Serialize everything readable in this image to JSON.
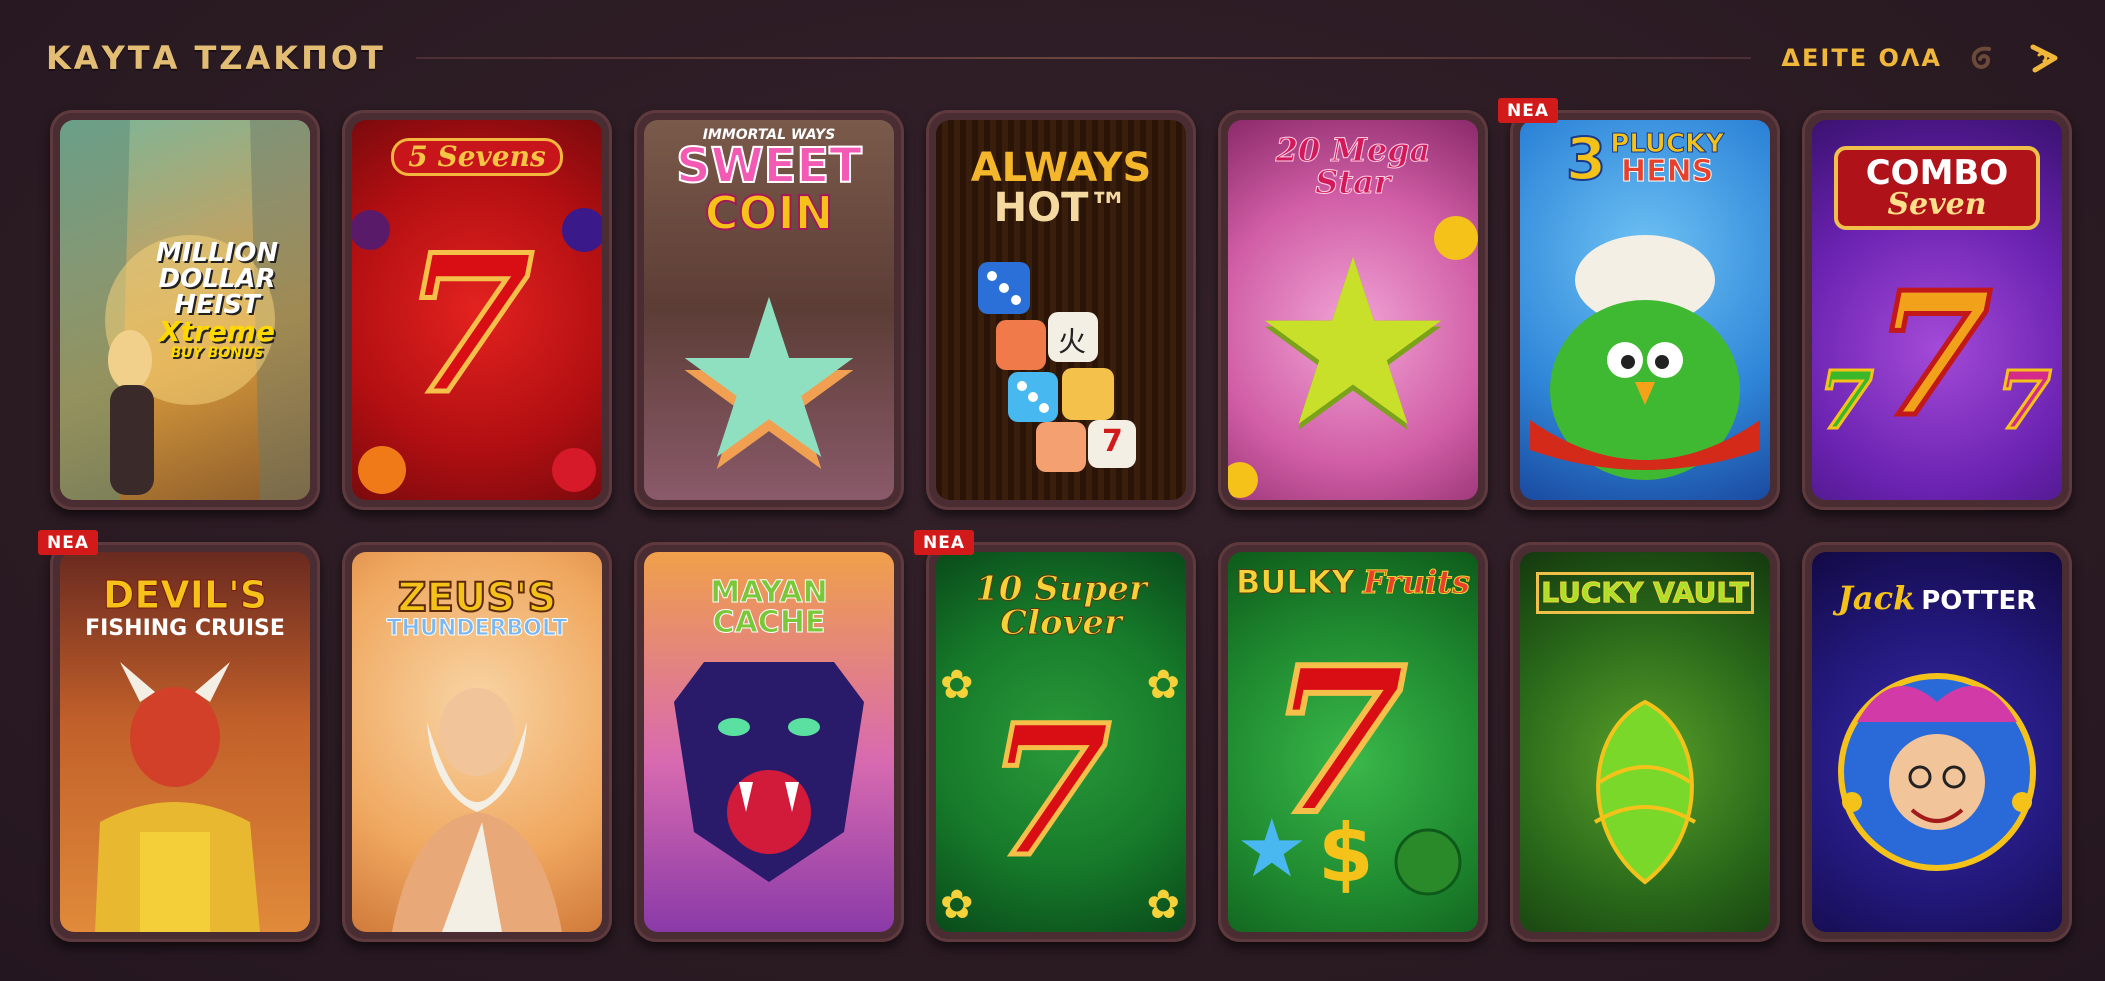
{
  "section": {
    "title": "ΚΑΥΤΑ ΤΖΑΚΠΟΤ",
    "see_all_label": "ΔΕΙΤΕ ΟΛΑ",
    "prev_icon": "swirl-left-icon",
    "next_icon": "swirl-right-icon"
  },
  "games": [
    {
      "name": "Million Dollar Heist Xtreme",
      "title_lines": [
        "MILLION",
        "DOLLAR",
        "HEIST",
        "Xtreme",
        "BUY BONUS"
      ],
      "badge": ""
    },
    {
      "name": "5 Sevens",
      "title_lines": [
        "5 Sevens"
      ],
      "badge": ""
    },
    {
      "name": "Sweet Coin",
      "title_lines": [
        "IMMORTAL WAYS",
        "SWEET",
        "COIN"
      ],
      "badge": ""
    },
    {
      "name": "Always Hot",
      "title_lines": [
        "ALWAYS",
        "HOT™"
      ],
      "badge": ""
    },
    {
      "name": "20 Mega Star",
      "title_lines": [
        "20 Mega",
        "Star"
      ],
      "badge": ""
    },
    {
      "name": "3 Plucky Hens",
      "title_lines": [
        "3",
        "PLUCKY",
        "HENS"
      ],
      "badge": "NEA"
    },
    {
      "name": "Combo Seven",
      "title_lines": [
        "COMBO",
        "Seven"
      ],
      "badge": ""
    },
    {
      "name": "Devil's Fishing Cruise",
      "title_lines": [
        "DEVIL'S",
        "FISHING CRUISE"
      ],
      "badge": "NEA"
    },
    {
      "name": "Zeus's Thunderbolt",
      "title_lines": [
        "ZEUS'S",
        "THUNDERBOLT"
      ],
      "badge": ""
    },
    {
      "name": "Mayan Cache",
      "title_lines": [
        "MAYAN CACHE"
      ],
      "badge": ""
    },
    {
      "name": "10 Super Clover",
      "title_lines": [
        "10 Super",
        "Clover"
      ],
      "badge": "NEA"
    },
    {
      "name": "Bulky Fruits",
      "title_lines": [
        "BULKY",
        "Fruits"
      ],
      "badge": ""
    },
    {
      "name": "Lucky Vault",
      "title_lines": [
        "LUCKY VAULT"
      ],
      "badge": ""
    },
    {
      "name": "Jack Potter",
      "title_lines": [
        "Jack",
        "POTTER"
      ],
      "badge": ""
    }
  ],
  "art_glyphs": {
    "seven": "7",
    "dice_glyphs": [
      "火",
      "7"
    ],
    "dollar": "$",
    "star": "★",
    "clover": "✿"
  },
  "colors": {
    "background": "#2d1d25",
    "accent_gold": "#f0b73a",
    "badge_red": "#d21a1a",
    "card_frame": "#4a2d33"
  }
}
